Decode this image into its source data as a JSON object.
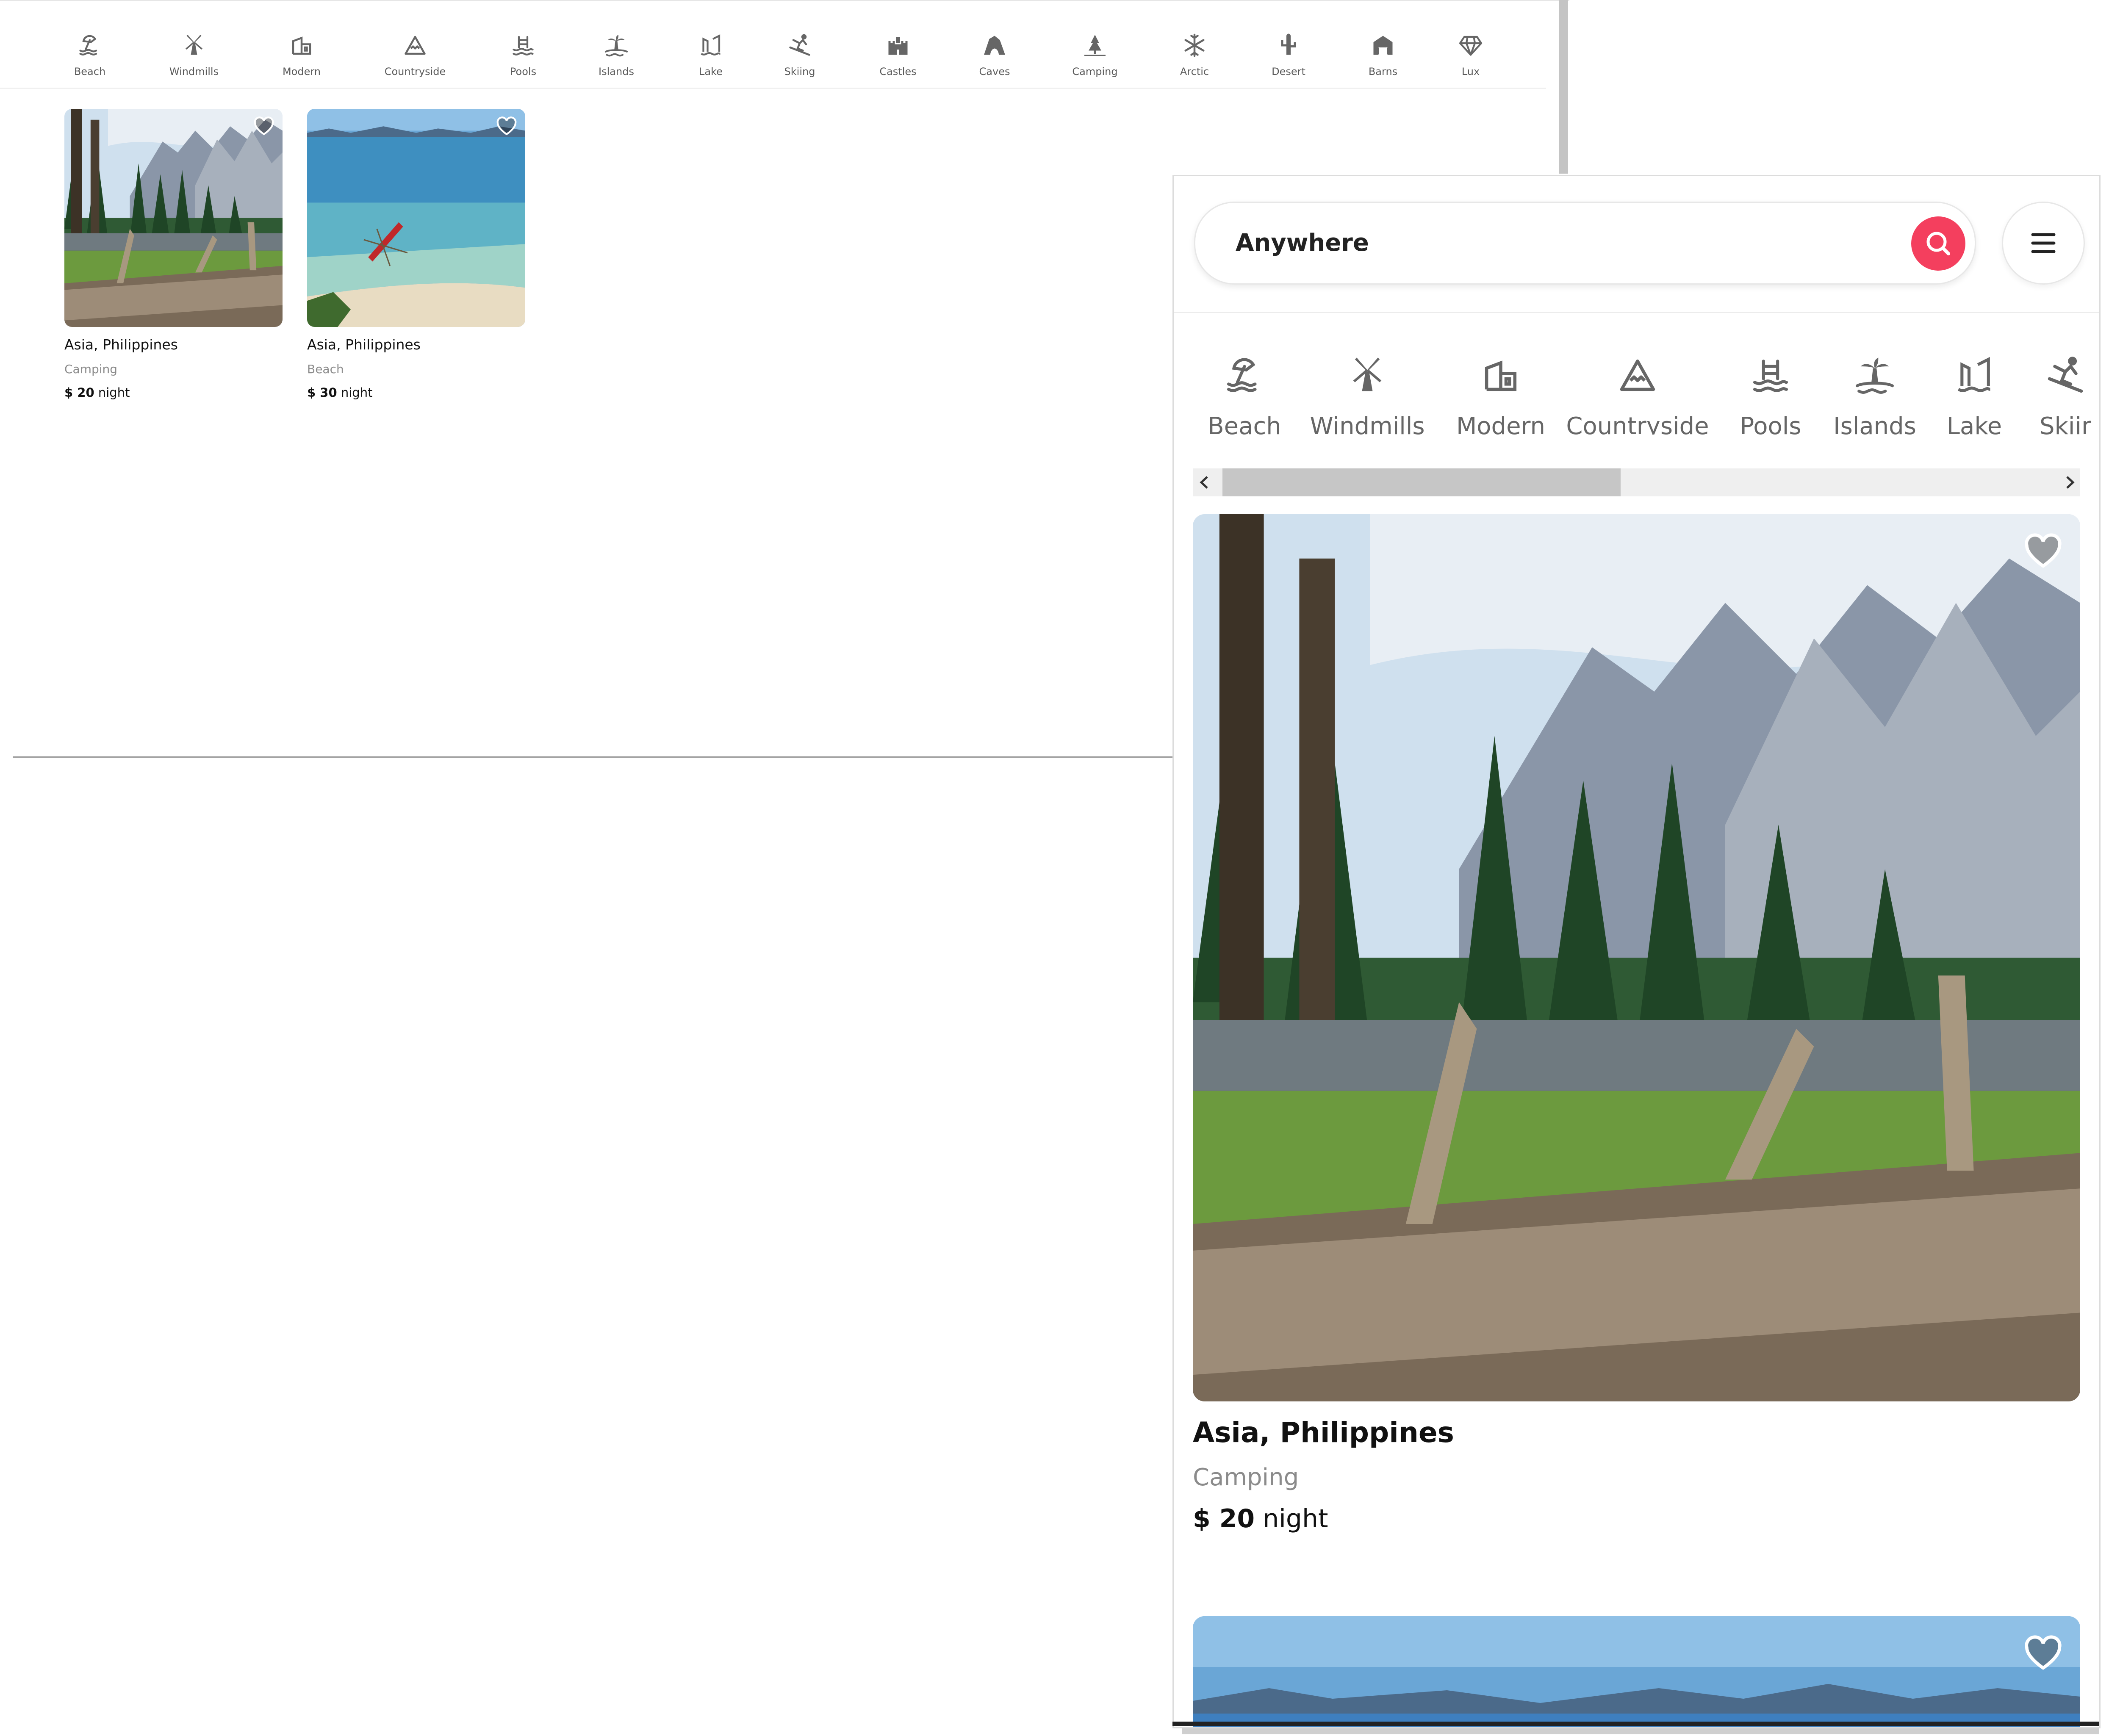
{
  "categories": [
    {
      "label": "Beach",
      "icon": "beach-icon"
    },
    {
      "label": "Windmills",
      "icon": "windmill-icon"
    },
    {
      "label": "Modern",
      "icon": "modern-house-icon"
    },
    {
      "label": "Countryside",
      "icon": "mountain-icon"
    },
    {
      "label": "Pools",
      "icon": "pool-icon"
    },
    {
      "label": "Islands",
      "icon": "island-icon"
    },
    {
      "label": "Lake",
      "icon": "lake-icon"
    },
    {
      "label": "Skiing",
      "icon": "skiing-icon"
    },
    {
      "label": "Castles",
      "icon": "castle-icon"
    },
    {
      "label": "Caves",
      "icon": "cave-icon"
    },
    {
      "label": "Camping",
      "icon": "camping-icon"
    },
    {
      "label": "Arctic",
      "icon": "snowflake-icon"
    },
    {
      "label": "Desert",
      "icon": "cactus-icon"
    },
    {
      "label": "Barns",
      "icon": "barn-icon"
    },
    {
      "label": "Lux",
      "icon": "diamond-icon"
    }
  ],
  "mobile_categories": [
    "Beach",
    "Windmills",
    "Modern",
    "Countryside",
    "Pools",
    "Islands",
    "Lake",
    "Skiir"
  ],
  "listings": [
    {
      "location": "Asia, Philippines",
      "category": "Camping",
      "price": "$ 20",
      "unit": "night",
      "image": "forest-lake-mountains-photo"
    },
    {
      "location": "Asia, Philippines",
      "category": "Beach",
      "price": "$ 30",
      "unit": "night",
      "image": "beach-island-kayak-photo"
    }
  ],
  "search": {
    "location_text": "Anywhere"
  },
  "colors": {
    "accent": "#f43f5e",
    "muted_text": "#8b8b8b",
    "icon": "#6b6b6b"
  }
}
